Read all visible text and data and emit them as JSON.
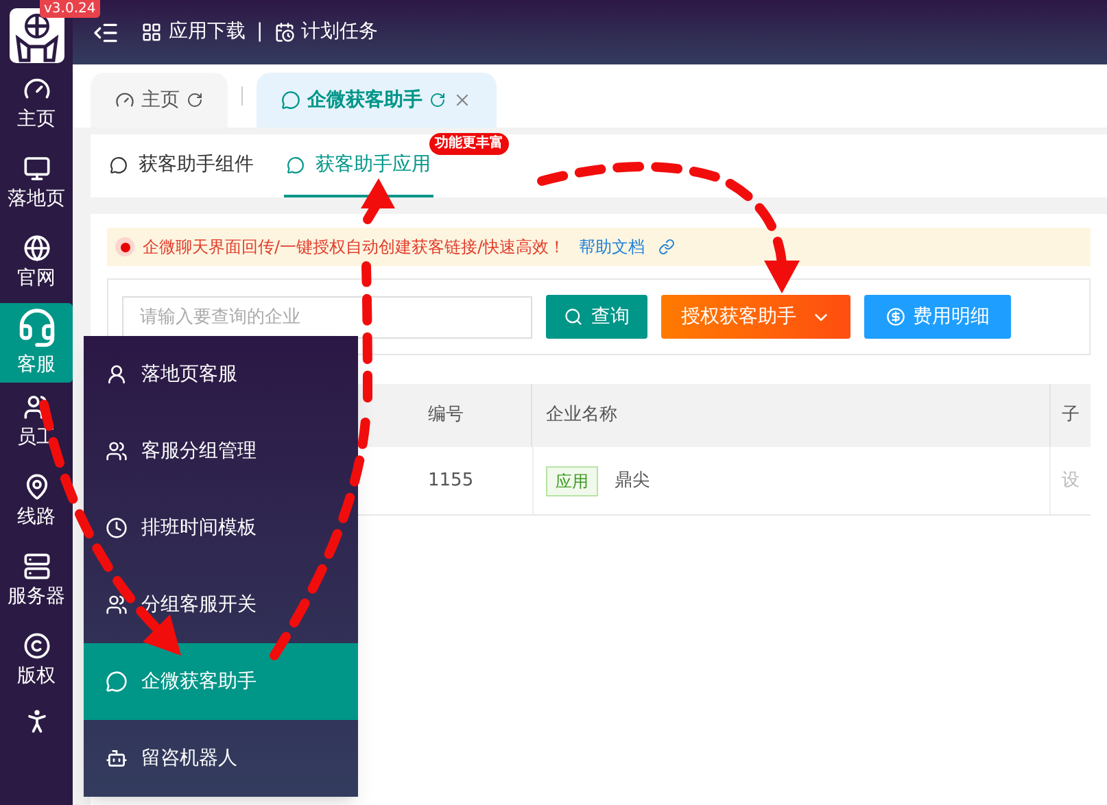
{
  "sidebar": {
    "version": "v3.0.24",
    "items": [
      {
        "label": "主页",
        "selected": false
      },
      {
        "label": "落地页",
        "selected": false
      },
      {
        "label": "官网",
        "selected": false
      },
      {
        "label": "客服",
        "selected": true
      },
      {
        "label": "员工",
        "selected": false
      },
      {
        "label": "线路",
        "selected": false
      },
      {
        "label": "服务器",
        "selected": false
      },
      {
        "label": "版权",
        "selected": false
      }
    ]
  },
  "topbar": {
    "links": [
      "应用下载",
      "计划任务"
    ],
    "separator": "|"
  },
  "tabs": [
    {
      "label": "主页",
      "selected": false
    },
    {
      "label": "企微获客助手",
      "selected": true
    }
  ],
  "subtabs": [
    {
      "label": "获客助手组件",
      "selected": false
    },
    {
      "label": "获客助手应用",
      "selected": true,
      "badge": "功能更丰富"
    }
  ],
  "notice": {
    "text": "企微聊天界面回传/一键授权自动创建获客链接/快速高效！",
    "link": "帮助文档"
  },
  "search": {
    "placeholder": "请输入要查询的企业"
  },
  "buttons": [
    {
      "label": "查询",
      "kind": "search"
    },
    {
      "label": "授权获客助手",
      "kind": "dropdown"
    },
    {
      "label": "费用明细",
      "kind": "fee"
    }
  ],
  "table": {
    "columns": [
      "编号",
      "企业名称",
      "子"
    ],
    "rows": [
      {
        "id": "1155",
        "tag": "应用",
        "name": "鼎尖",
        "column_4": "设"
      }
    ]
  },
  "flyout_menu": {
    "items": [
      {
        "label": "落地页客服",
        "selected": false
      },
      {
        "label": "客服分组管理",
        "selected": false
      },
      {
        "label": "排班时间模板",
        "selected": false
      },
      {
        "label": "分组客服开关",
        "selected": false
      },
      {
        "label": "企微获客助手",
        "selected": true
      },
      {
        "label": "留咨机器人",
        "selected": false
      }
    ]
  }
}
